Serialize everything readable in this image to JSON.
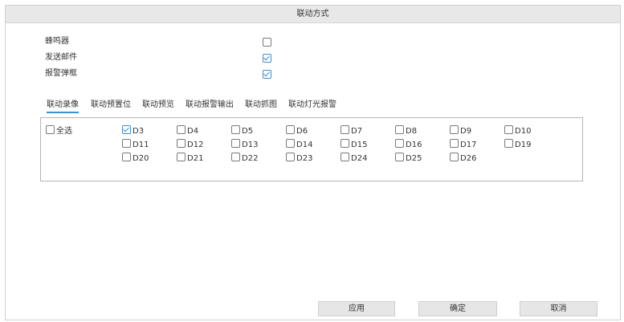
{
  "dialog": {
    "title": "联动方式"
  },
  "options": [
    {
      "label": "蜂鸣器",
      "checked": false
    },
    {
      "label": "发送邮件",
      "checked": true
    },
    {
      "label": "报警弹框",
      "checked": true
    }
  ],
  "tabs": [
    {
      "label": "联动录像",
      "active": true
    },
    {
      "label": "联动预置位",
      "active": false
    },
    {
      "label": "联动预览",
      "active": false
    },
    {
      "label": "联动报警输出",
      "active": false
    },
    {
      "label": "联动抓图",
      "active": false
    },
    {
      "label": "联动灯光报警",
      "active": false
    }
  ],
  "channels": {
    "select_all": {
      "label": "全选",
      "checked": false
    },
    "items": [
      {
        "label": "D3",
        "checked": true
      },
      {
        "label": "D4",
        "checked": false
      },
      {
        "label": "D5",
        "checked": false
      },
      {
        "label": "D6",
        "checked": false
      },
      {
        "label": "D7",
        "checked": false
      },
      {
        "label": "D8",
        "checked": false
      },
      {
        "label": "D9",
        "checked": false
      },
      {
        "label": "D10",
        "checked": false
      },
      {
        "label": "D11",
        "checked": false
      },
      {
        "label": "D12",
        "checked": false
      },
      {
        "label": "D13",
        "checked": false
      },
      {
        "label": "D14",
        "checked": false
      },
      {
        "label": "D15",
        "checked": false
      },
      {
        "label": "D16",
        "checked": false
      },
      {
        "label": "D17",
        "checked": false
      },
      {
        "label": "D19",
        "checked": false
      },
      {
        "label": "D20",
        "checked": false
      },
      {
        "label": "D21",
        "checked": false
      },
      {
        "label": "D22",
        "checked": false
      },
      {
        "label": "D23",
        "checked": false
      },
      {
        "label": "D24",
        "checked": false
      },
      {
        "label": "D25",
        "checked": false
      },
      {
        "label": "D26",
        "checked": false
      }
    ]
  },
  "buttons": {
    "apply": "应用",
    "ok": "确定",
    "cancel": "取消"
  },
  "colors": {
    "accent": "#3a8fd6",
    "title_bar": "#e8e8e8",
    "button_bg": "#e6e6e6"
  }
}
